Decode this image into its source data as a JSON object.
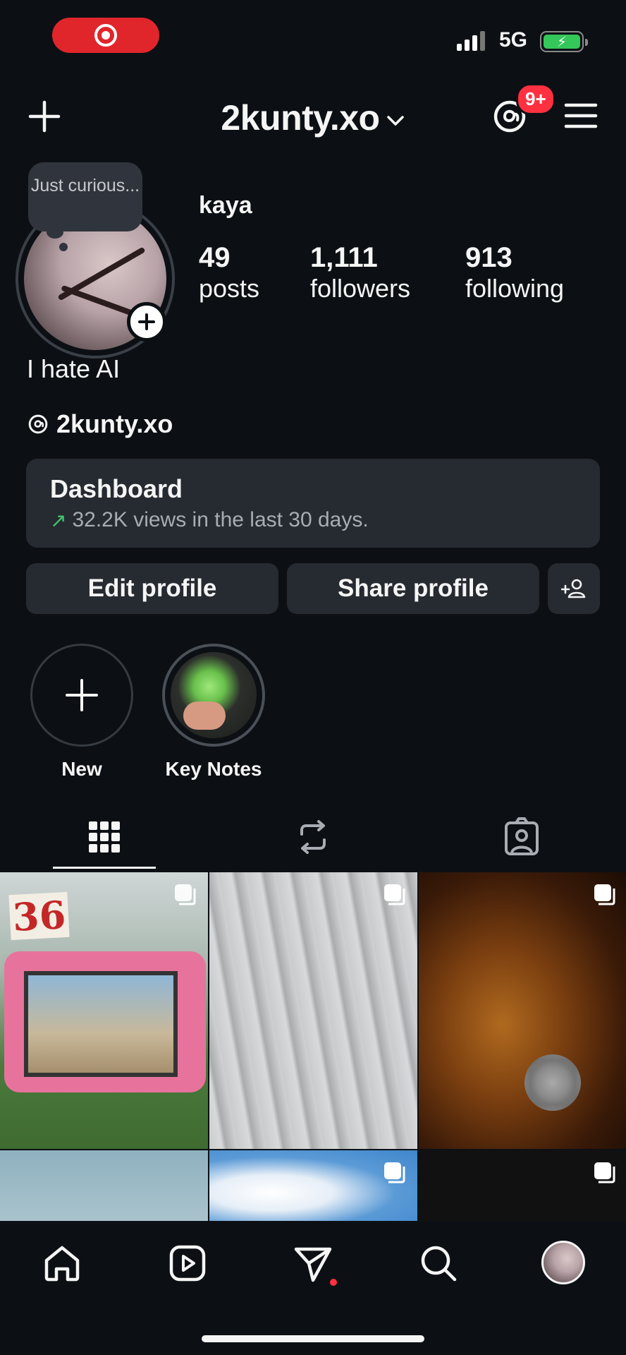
{
  "status_bar": {
    "network": "5G"
  },
  "header": {
    "username": "2kunty.xo",
    "notification_badge": "9+"
  },
  "profile": {
    "note": "Just curious...",
    "display_name": "kaya",
    "stats": [
      {
        "value": "49",
        "label": "posts"
      },
      {
        "value": "1,111",
        "label": "followers"
      },
      {
        "value": "913",
        "label": "following"
      }
    ],
    "bio": "I hate AI",
    "threads_handle": "2kunty.xo"
  },
  "dashboard": {
    "title": "Dashboard",
    "subtitle": "32.2K views in the last 30 days."
  },
  "buttons": {
    "edit": "Edit profile",
    "share": "Share profile"
  },
  "highlights": [
    {
      "label": "New"
    },
    {
      "label": "Key Notes"
    }
  ],
  "grid": {
    "first_post_text": "36"
  },
  "colors": {
    "background": "#0c1014",
    "card": "#262a31",
    "badge": "#ff3040",
    "trend": "#3fc76a"
  }
}
